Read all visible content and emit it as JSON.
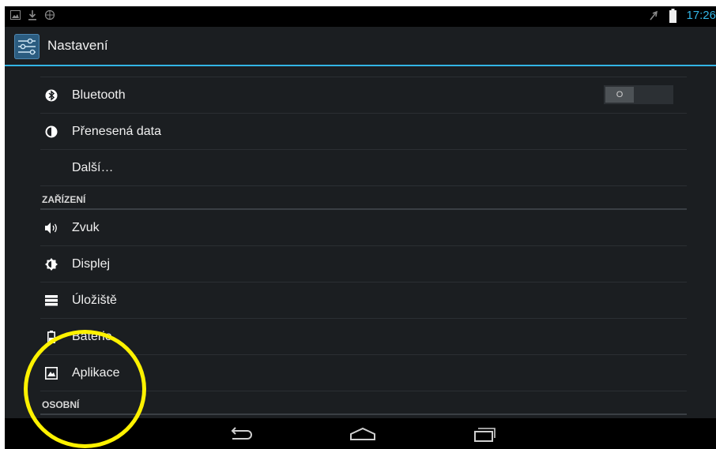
{
  "status_bar": {
    "time": "17:26",
    "left_icons": [
      "image-icon",
      "download-icon",
      "network-icon"
    ],
    "right_icons": [
      "signal-off-icon",
      "battery-icon"
    ]
  },
  "action_bar": {
    "title": "Nastavení",
    "icon": "settings-icon"
  },
  "rows": [
    {
      "label": "Bluetooth",
      "icon": "bluetooth-icon",
      "toggle": "O"
    },
    {
      "label": "Přenesená data",
      "icon": "data-usage-icon"
    },
    {
      "label": "Další…",
      "icon": ""
    }
  ],
  "sections": {
    "device": "ZAŘÍZENÍ",
    "personal": "OSOBNÍ"
  },
  "device_rows": [
    {
      "label": "Zvuk",
      "icon": "sound-icon"
    },
    {
      "label": "Displej",
      "icon": "display-icon"
    },
    {
      "label": "Úložiště",
      "icon": "storage-icon"
    },
    {
      "label": "Baterie",
      "icon": "battery-icon"
    },
    {
      "label": "Aplikace",
      "icon": "apps-icon"
    }
  ],
  "nav_bar": [
    "back-icon",
    "home-icon",
    "recents-icon"
  ],
  "colors": {
    "accent": "#33b5e5",
    "highlight": "#fff200",
    "background": "#1b1e21"
  }
}
